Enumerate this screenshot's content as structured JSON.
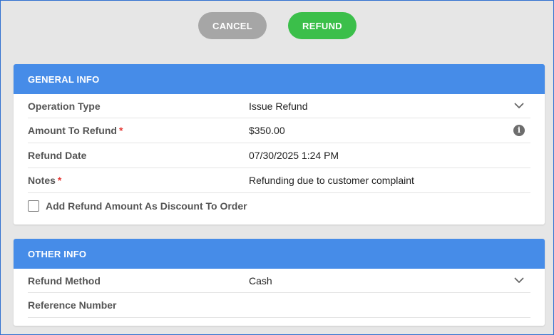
{
  "actions": {
    "cancel_label": "CANCEL",
    "refund_label": "REFUND"
  },
  "general_info": {
    "title": "GENERAL INFO",
    "operation_type": {
      "label": "Operation Type",
      "value": "Issue Refund"
    },
    "amount_to_refund": {
      "label": "Amount To Refund",
      "required": "*",
      "value": "$350.00"
    },
    "refund_date": {
      "label": "Refund Date",
      "value": "07/30/2025 1:24 PM"
    },
    "notes": {
      "label": "Notes",
      "required": "*",
      "value": "Refunding due to customer complaint"
    },
    "discount_checkbox": {
      "label": "Add Refund Amount As Discount To Order",
      "checked": false
    }
  },
  "other_info": {
    "title": "OTHER INFO",
    "refund_method": {
      "label": "Refund Method",
      "value": "Cash"
    },
    "reference_number": {
      "label": "Reference Number",
      "value": ""
    }
  },
  "colors": {
    "header_blue": "#468ce8",
    "refund_green": "#3bbf4a",
    "cancel_gray": "#a6a6a6",
    "required_red": "#e53935"
  },
  "icons": {
    "dropdown": "chevron-down-icon",
    "info": "info-icon"
  }
}
